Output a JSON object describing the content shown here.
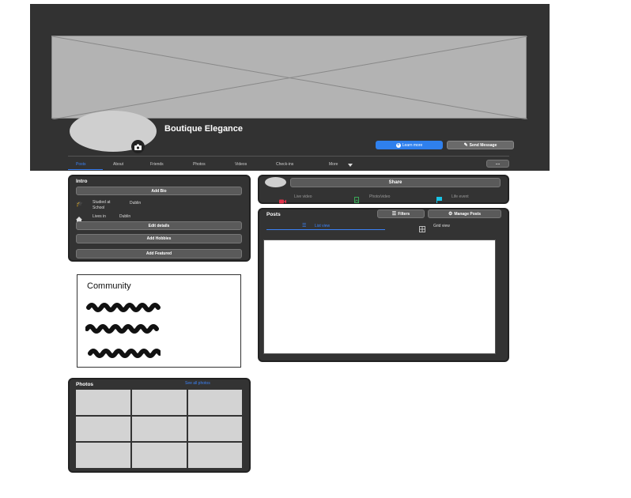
{
  "header": {
    "page_name": "Boutique Elegance",
    "learn_more": "Learn more",
    "send_message": "Send Message",
    "more_options": "....",
    "tabs": [
      "Posts",
      "About",
      "Friends",
      "Photos",
      "Videos",
      "Check-ins",
      "More"
    ],
    "active_tab_color": "#3b82f6"
  },
  "intro": {
    "title": "Intro",
    "add_bio": "Add Bio",
    "studied_label": "Studied at School",
    "studied_value": "Dublin",
    "lives_label": "Lives in",
    "lives_value": "Dublin",
    "edit_details": "Edit details",
    "add_hobbies": "Add Hobbies",
    "add_featured": "Add Featured"
  },
  "community": {
    "title": "Community"
  },
  "photos": {
    "title": "Photos",
    "see_all": "See all photos"
  },
  "composer": {
    "share": "Share",
    "live_video": "Live video",
    "photo_video": "Photo/video",
    "life_event": "Life event"
  },
  "posts": {
    "title": "Posts",
    "filters": "Filters",
    "manage_posts": "Manage Posts",
    "list_view": "List view",
    "grid_view": "Grid view"
  },
  "colors": {
    "accent": "#2f80ed",
    "link": "#3b82f6",
    "dark_panel": "#333333",
    "live_red": "#e0334a",
    "photo_green": "#3aa757",
    "flag_cyan": "#18c4e6"
  }
}
